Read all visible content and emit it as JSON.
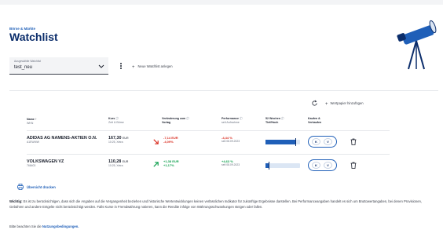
{
  "header": {
    "breadcrumb": "Börse & Märkte",
    "title": "Watchlist"
  },
  "watchlist_select": {
    "label": "Ausgewählte Watchlist",
    "value": "test_neu"
  },
  "actions": {
    "new_watchlist": "Neue Watchlist anlegen",
    "add_security": "Wertpapier hinzufügen"
  },
  "table": {
    "headers": {
      "name": "Name",
      "name_sub": "WKN",
      "price": "Kurs",
      "price_sub": "Zeit & Börse",
      "change": "Veränderung zum",
      "change_sub": "Vortag",
      "performance": "Performance",
      "performance_sub": "seit Aufnahme",
      "weeks52": "52 Wochen",
      "weeks52_sub": "Tief/Hoch",
      "trade": "Kaufen &",
      "trade_sub": "Verkaufen"
    },
    "rows": [
      {
        "name": "ADIDAS AG NAMENS-AKTIEN O.N.",
        "wkn": "A1EWWW",
        "price": "167,30",
        "currency": "EUR",
        "time": "10:25, Xetra",
        "change_abs": "-7,14 EUR",
        "change_pct": "-4,09%",
        "direction": "down",
        "perf": "-4,44 %",
        "perf_since": "seit 08.09.2023",
        "range_position": 0.88,
        "buy": "K",
        "sell": "V"
      },
      {
        "name": "VOLKSWAGEN VZ",
        "wkn": "766403",
        "price": "110,28",
        "currency": "EUR",
        "time": "10:25, Xetra",
        "change_abs": "+1,38 EUR",
        "change_pct": "+1,17%",
        "direction": "up",
        "perf": "+4,63 %",
        "perf_since": "seit 08.09.2023",
        "range_position": 0.1,
        "buy": "K",
        "sell": "V"
      }
    ]
  },
  "print_label": "Übersicht drucken",
  "disclaimer": {
    "lead": "Wichtig:",
    "text": " Es ist zu berücksichtigen, dass sich die Angaben auf die Vergangenheit beziehen und historische Wertentwicklungen keinen verlässlichen Indikator für zukünftige Ergebnisse darstellen. Bei Performanceangaben handelt es sich um Bruttowertangaben, bei denen Provisionen, Gebühren und andere Entgelte nicht berücksichtigt werden. Falls Kurse in Fremdwährung notieren, kann die Rendite infolge von Währungsschwankungen steigen oder fallen."
  },
  "terms": {
    "prefix": "Bitte beachten Sie die ",
    "link": "Nutzungsbedingungen."
  },
  "colors": {
    "brand": "#0b2d6b",
    "accent": "#1f5fb8",
    "negative": "#d92d20",
    "positive": "#12a150"
  }
}
